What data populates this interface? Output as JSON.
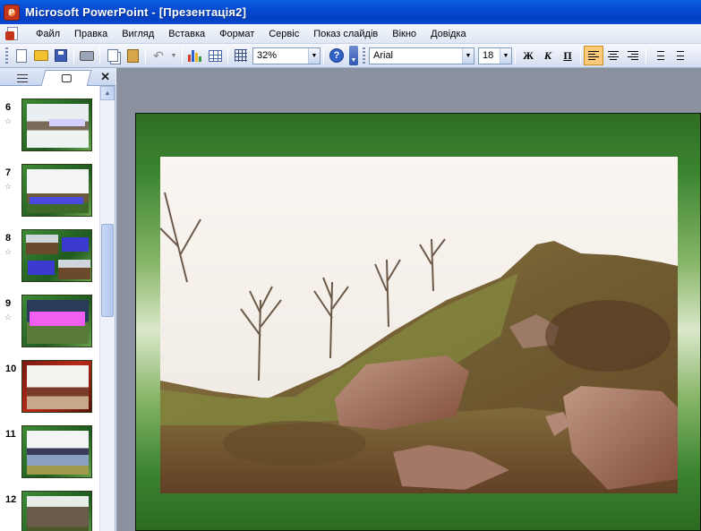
{
  "window": {
    "title": "Microsoft PowerPoint - [Презентація2]"
  },
  "menu": {
    "items": [
      "Файл",
      "Правка",
      "Вигляд",
      "Вставка",
      "Формат",
      "Сервіс",
      "Показ слайдів",
      "Вікно",
      "Довідка"
    ]
  },
  "toolbar": {
    "zoom": "32%",
    "font_name": "Arial",
    "font_size": "18",
    "bold_label": "Ж",
    "italic_label": "К",
    "underline_label": "П",
    "icons": [
      "new-icon",
      "open-icon",
      "save-icon",
      "print-icon",
      "copy-icon",
      "paste-icon",
      "undo-icon",
      "chart-icon",
      "table-icon",
      "grid-icon",
      "help-icon",
      "align-left-icon",
      "align-center-icon",
      "align-right-icon",
      "numbering-icon",
      "bullets-icon"
    ]
  },
  "slides_pane": {
    "close_label": "✕",
    "slides": [
      {
        "number": "6",
        "has_animation": true
      },
      {
        "number": "7",
        "has_animation": true
      },
      {
        "number": "8",
        "has_animation": true
      },
      {
        "number": "9",
        "has_animation": true
      },
      {
        "number": "10",
        "has_animation": false
      },
      {
        "number": "11",
        "has_animation": false
      },
      {
        "number": "12",
        "has_animation": false
      }
    ]
  },
  "colors": {
    "titlebar": "#0448cf",
    "slide_green": "#2f6e24",
    "active_format": "#ffc97a"
  }
}
